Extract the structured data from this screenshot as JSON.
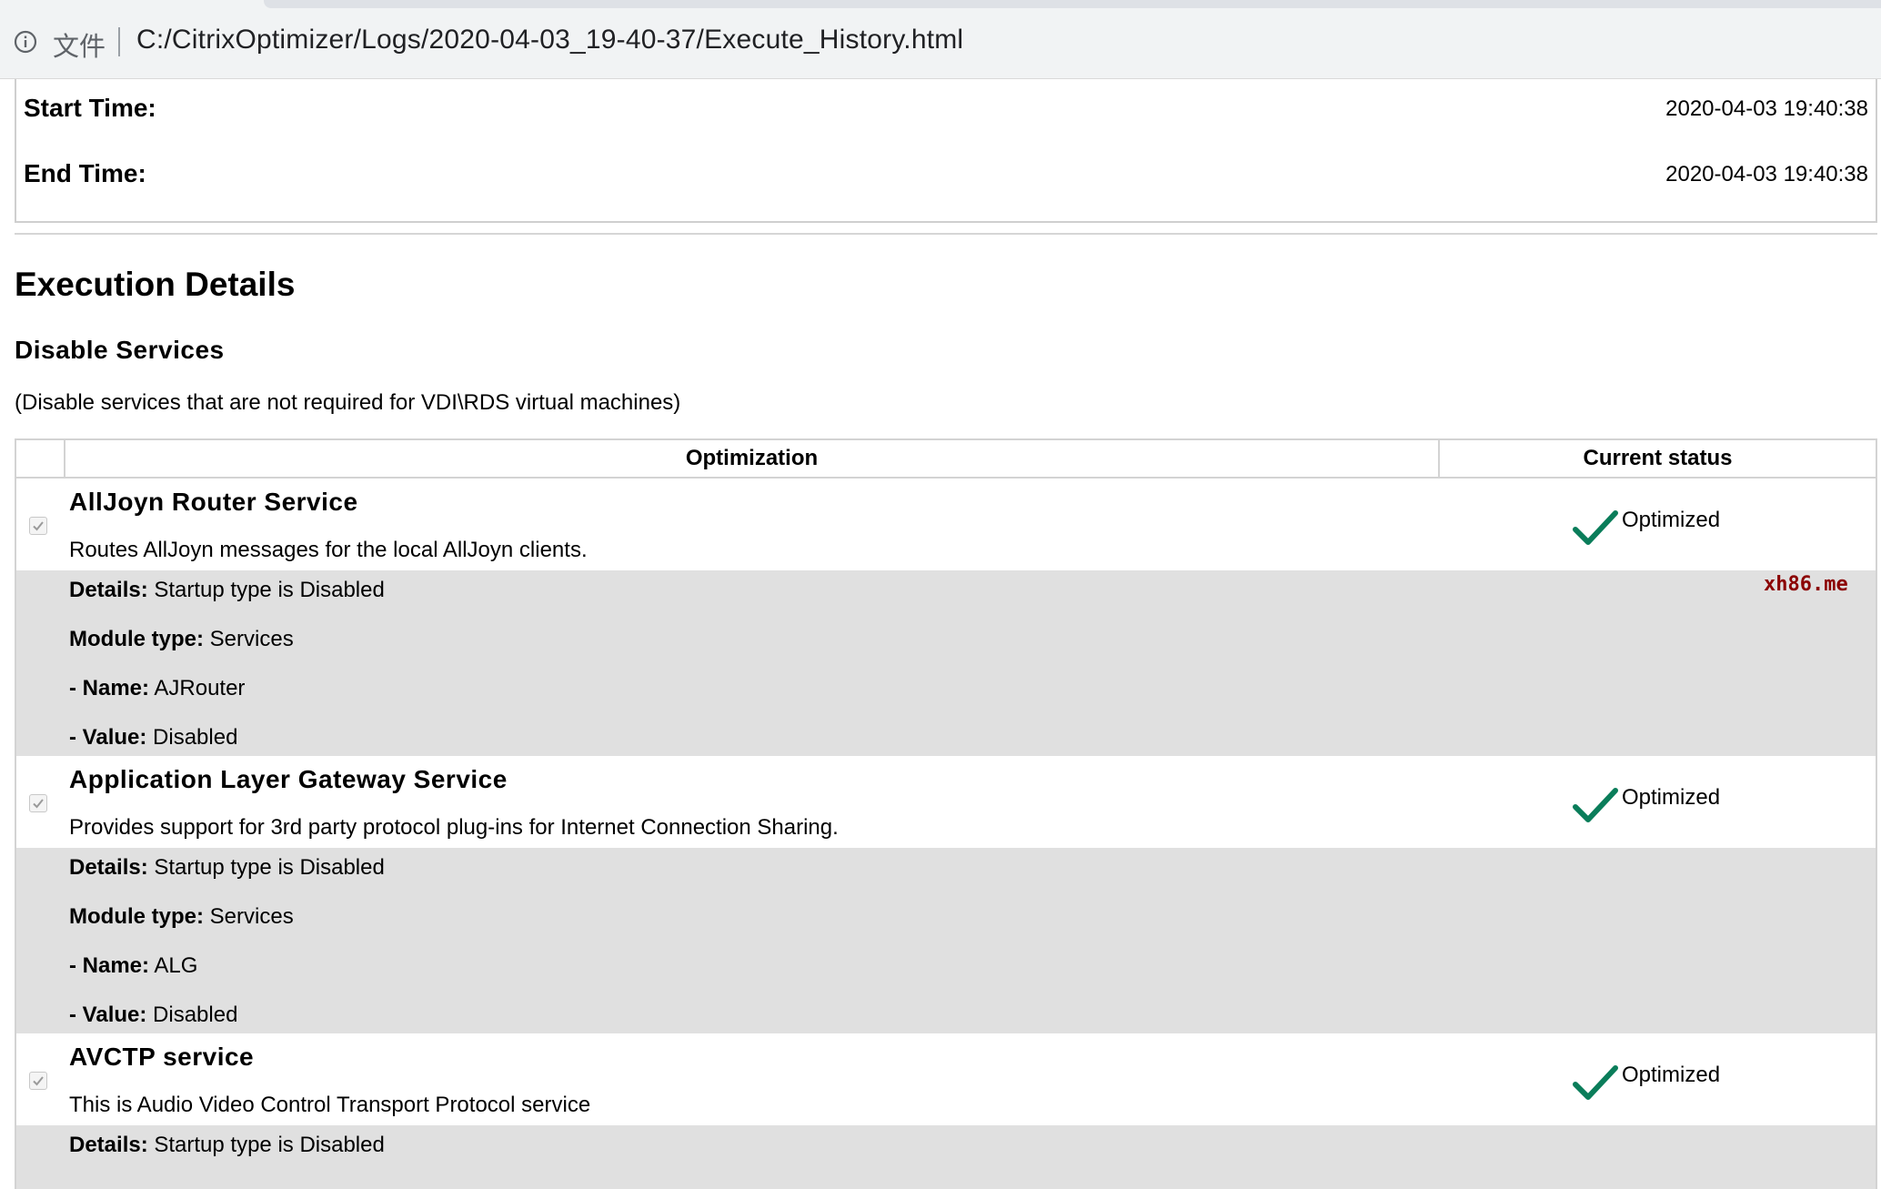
{
  "browser": {
    "file_label": "文件",
    "url": "C:/CitrixOptimizer/Logs/2020-04-03_19-40-37/Execute_History.html"
  },
  "times": {
    "start_label": "Start Time:",
    "start_value": "2020-04-03 19:40:38",
    "end_label": "End Time:",
    "end_value": "2020-04-03 19:40:38"
  },
  "section": {
    "title": "Execution Details",
    "group_title": "Disable Services",
    "group_description": "(Disable services that are not required for VDI\\RDS virtual machines)"
  },
  "table": {
    "col_optimization": "Optimization",
    "col_status": "Current status"
  },
  "items": [
    {
      "name": "AllJoyn Router Service",
      "description": "Routes AllJoyn messages for the local AllJoyn clients.",
      "status": "Optimized",
      "details_label": "Details:",
      "details_value": " Startup type is Disabled",
      "module_label": "Module type:",
      "module_value": " Services",
      "name_label": "- Name:",
      "name_value": " AJRouter",
      "value_label": "- Value:",
      "value_value": " Disabled"
    },
    {
      "name": "Application Layer Gateway Service",
      "description": "Provides support for 3rd party protocol plug-ins for Internet Connection Sharing.",
      "status": "Optimized",
      "details_label": "Details:",
      "details_value": " Startup type is Disabled",
      "module_label": "Module type:",
      "module_value": " Services",
      "name_label": "- Name:",
      "name_value": " ALG",
      "value_label": "- Value:",
      "value_value": " Disabled"
    },
    {
      "name": "AVCTP service",
      "description": "This is Audio Video Control Transport Protocol service",
      "status": "Optimized",
      "details_label": "Details:",
      "details_value": " Startup type is Disabled"
    }
  ],
  "watermark": "xh86.me",
  "colors": {
    "check_green": "#0a7d5a",
    "details_bg": "#e0e0e0",
    "watermark": "#8b0000"
  }
}
